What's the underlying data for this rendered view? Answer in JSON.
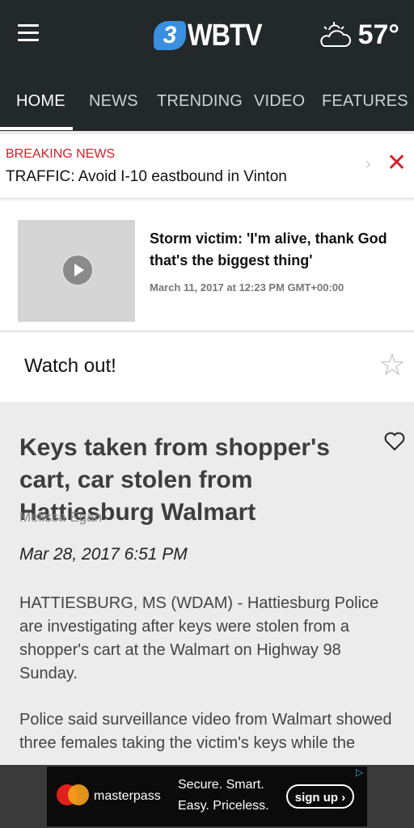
{
  "header": {
    "logo_mark": "3",
    "logo_text": "WBTV",
    "temperature": "57°",
    "tabs": [
      {
        "label": "HOME"
      },
      {
        "label": "NEWS"
      },
      {
        "label": "TRENDING"
      },
      {
        "label": "VIDEO"
      },
      {
        "label": "FEATURES"
      }
    ]
  },
  "breaking": {
    "label": "BREAKING NEWS",
    "text": "TRAFFIC: Avoid I-10 eastbound in Vinton"
  },
  "promo": {
    "title": "Storm victim: 'I'm alive, thank God that's the biggest thing'",
    "date": "March 11, 2017 at 12:23 PM GMT+00:00"
  },
  "watch": {
    "label": "Watch out!"
  },
  "article": {
    "title": "Keys taken from shopper's cart, car stolen from Hattiesburg Walmart",
    "author": "Melissa Egan",
    "date": "Mar 28, 2017 6:51 PM",
    "paragraphs": [
      "HATTIESBURG, MS (WDAM) - Hattiesburg Police are investigating after keys were stolen from a shopper's cart at the Walmart on Highway 98 Sunday.",
      "Police said surveillance video from Walmart showed three females taking the victim's keys while the"
    ]
  },
  "ad": {
    "brand": "masterpass",
    "tagline_1": "Secure. Smart.",
    "tagline_2": "Easy. Priceless.",
    "cta": "sign up ›"
  },
  "colors": {
    "header_bg": "#23282b",
    "breaking_red": "#d6202a",
    "logo_blue": "#3a8fe0"
  }
}
